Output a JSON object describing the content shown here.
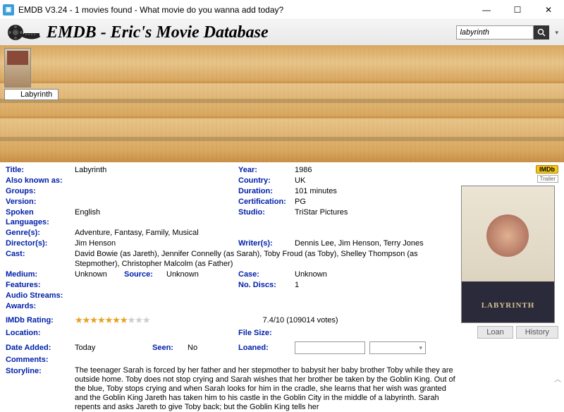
{
  "window": {
    "title": "EMDB V3.24 - 1 movies found - What movie do you wanna add today?"
  },
  "header": {
    "title": "EMDB - Eric's Movie Database",
    "search_value": "labyrinth"
  },
  "shelf": {
    "selected_label": "Labyrinth"
  },
  "badges": {
    "imdb": "IMDb",
    "trailer": "Trailer"
  },
  "labels": {
    "title": "Title:",
    "aka": "Also known as:",
    "groups": "Groups:",
    "version": "Version:",
    "spoken": "Spoken Languages:",
    "genres": "Genre(s):",
    "directors": "Director(s):",
    "cast": "Cast:",
    "medium": "Medium:",
    "source": "Source:",
    "features": "Features:",
    "audio": "Audio Streams:",
    "awards": "Awards:",
    "imdb_rating": "IMDb Rating:",
    "location": "Location:",
    "date_added": "Date Added:",
    "seen": "Seen:",
    "comments": "Comments:",
    "storyline": "Storyline:",
    "year": "Year:",
    "country": "Country:",
    "duration": "Duration:",
    "certification": "Certification:",
    "studio": "Studio:",
    "writers": "Writer(s):",
    "case": "Case:",
    "no_discs": "No. Discs:",
    "file_size": "File Size:",
    "loaned": "Loaned:"
  },
  "movie": {
    "title": "Labyrinth",
    "aka": "",
    "groups": "",
    "version": "",
    "spoken": "English",
    "genres": "Adventure, Fantasy, Family, Musical",
    "directors": "Jim Henson",
    "cast": "David Bowie  (as Jareth), Jennifer Connelly  (as Sarah), Toby Froud  (as Toby), Shelley Thompson  (as Stepmother), Christopher Malcolm  (as Father)",
    "medium": "Unknown",
    "source": "Unknown",
    "features": "",
    "audio": "",
    "awards": "",
    "rating_text": "7.4/10  (109014 votes)",
    "location": "",
    "date_added": "Today",
    "seen": "No",
    "comments": "",
    "storyline": "The teenager Sarah is forced by her father and her stepmother to babysit her baby brother Toby while they are outside home. Toby does not stop crying and Sarah wishes that her brother be taken by the Goblin King. Out of the blue, Toby stops crying and when Sarah looks for him in the cradle, she learns that her wish was granted and the Goblin King Jareth has taken him to his castle in the Goblin City in the middle of a labyrinth. Sarah repents and asks Jareth to give Toby back; but the Goblin King tells her",
    "year": "1986",
    "country": "UK",
    "duration": "101 minutes",
    "certification": "PG",
    "studio": "TriStar Pictures",
    "writers": "Dennis Lee, Jim Henson, Terry Jones",
    "case": "Unknown",
    "no_discs": "1",
    "file_size": "",
    "loaned": ""
  },
  "buttons": {
    "loan": "Loan",
    "history": "History"
  }
}
